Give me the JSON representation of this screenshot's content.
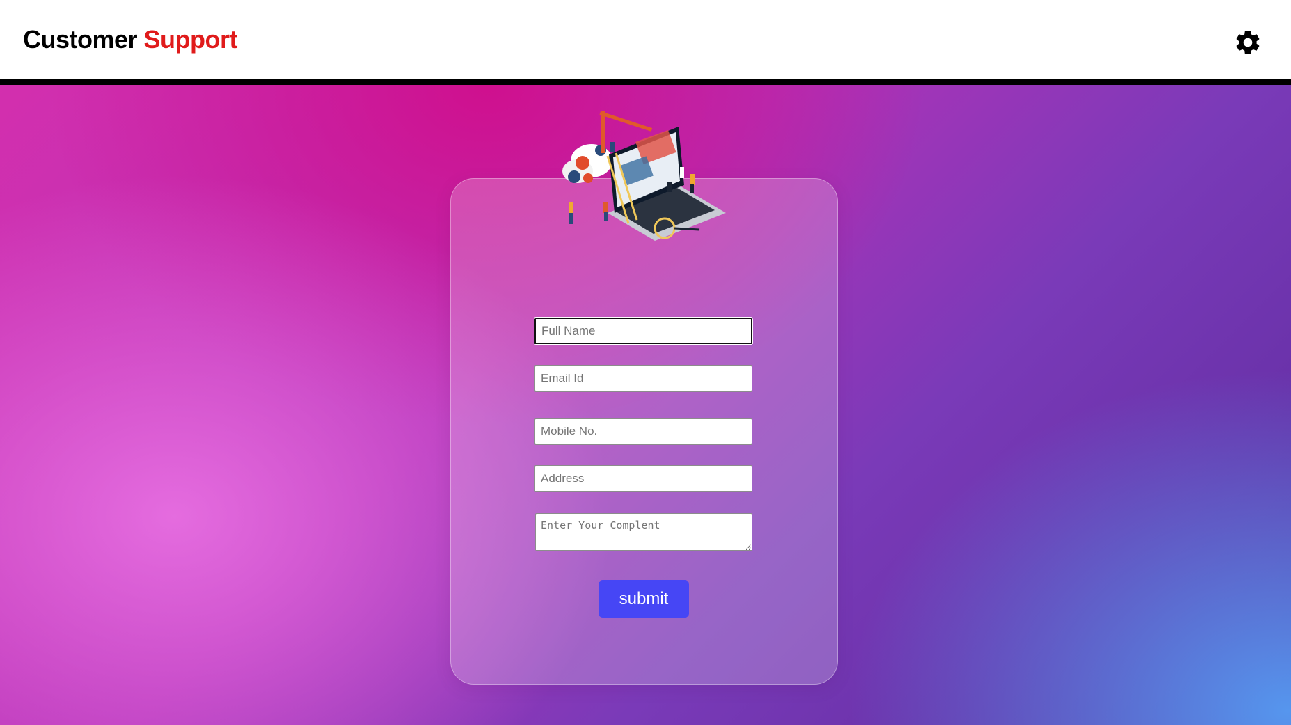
{
  "header": {
    "title_part1": "Customer",
    "title_part2": "Support",
    "settings_icon": "gear-icon"
  },
  "colors": {
    "title_accent": "#e01b1b",
    "submit_button": "#4646f5",
    "header_border": "#000000"
  },
  "form": {
    "illustration_icon": "laptop-construction-illustration",
    "full_name_placeholder": "Full Name",
    "email_placeholder": "Email Id",
    "mobile_placeholder": "Mobile No.",
    "address_placeholder": "Address",
    "complaint_placeholder": "Enter Your Complent",
    "submit_label": "submit"
  }
}
